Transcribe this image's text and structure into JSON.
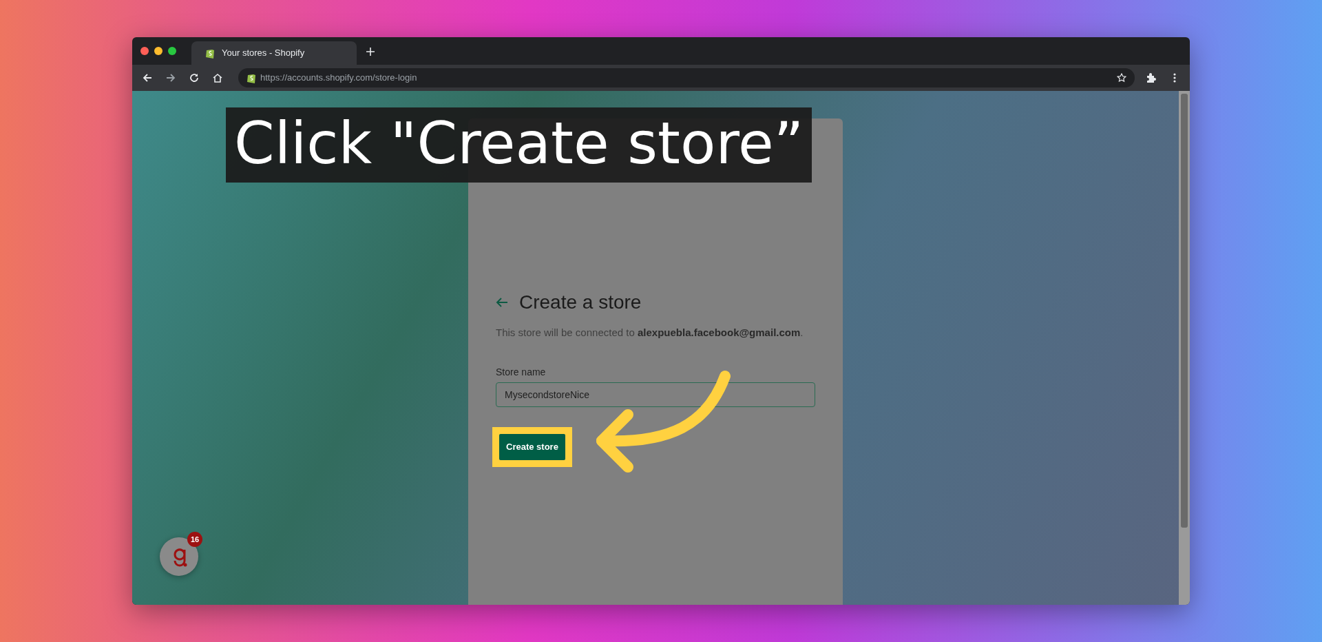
{
  "browser": {
    "tab": {
      "title": "Your stores - Shopify",
      "selected": true
    },
    "address": "https://accounts.shopify.com/store-login"
  },
  "caption": "Click \"Create store”",
  "form": {
    "title": "Create a store",
    "note": "This store will be connected to **alexpuebla.facebook@gmail.com**.",
    "field_label": "Store name",
    "field_value": "MysecondstoreNice",
    "button": {
      "label": "Create store",
      "highlighted": true
    }
  },
  "chat_widget": {
    "badge": "16"
  }
}
